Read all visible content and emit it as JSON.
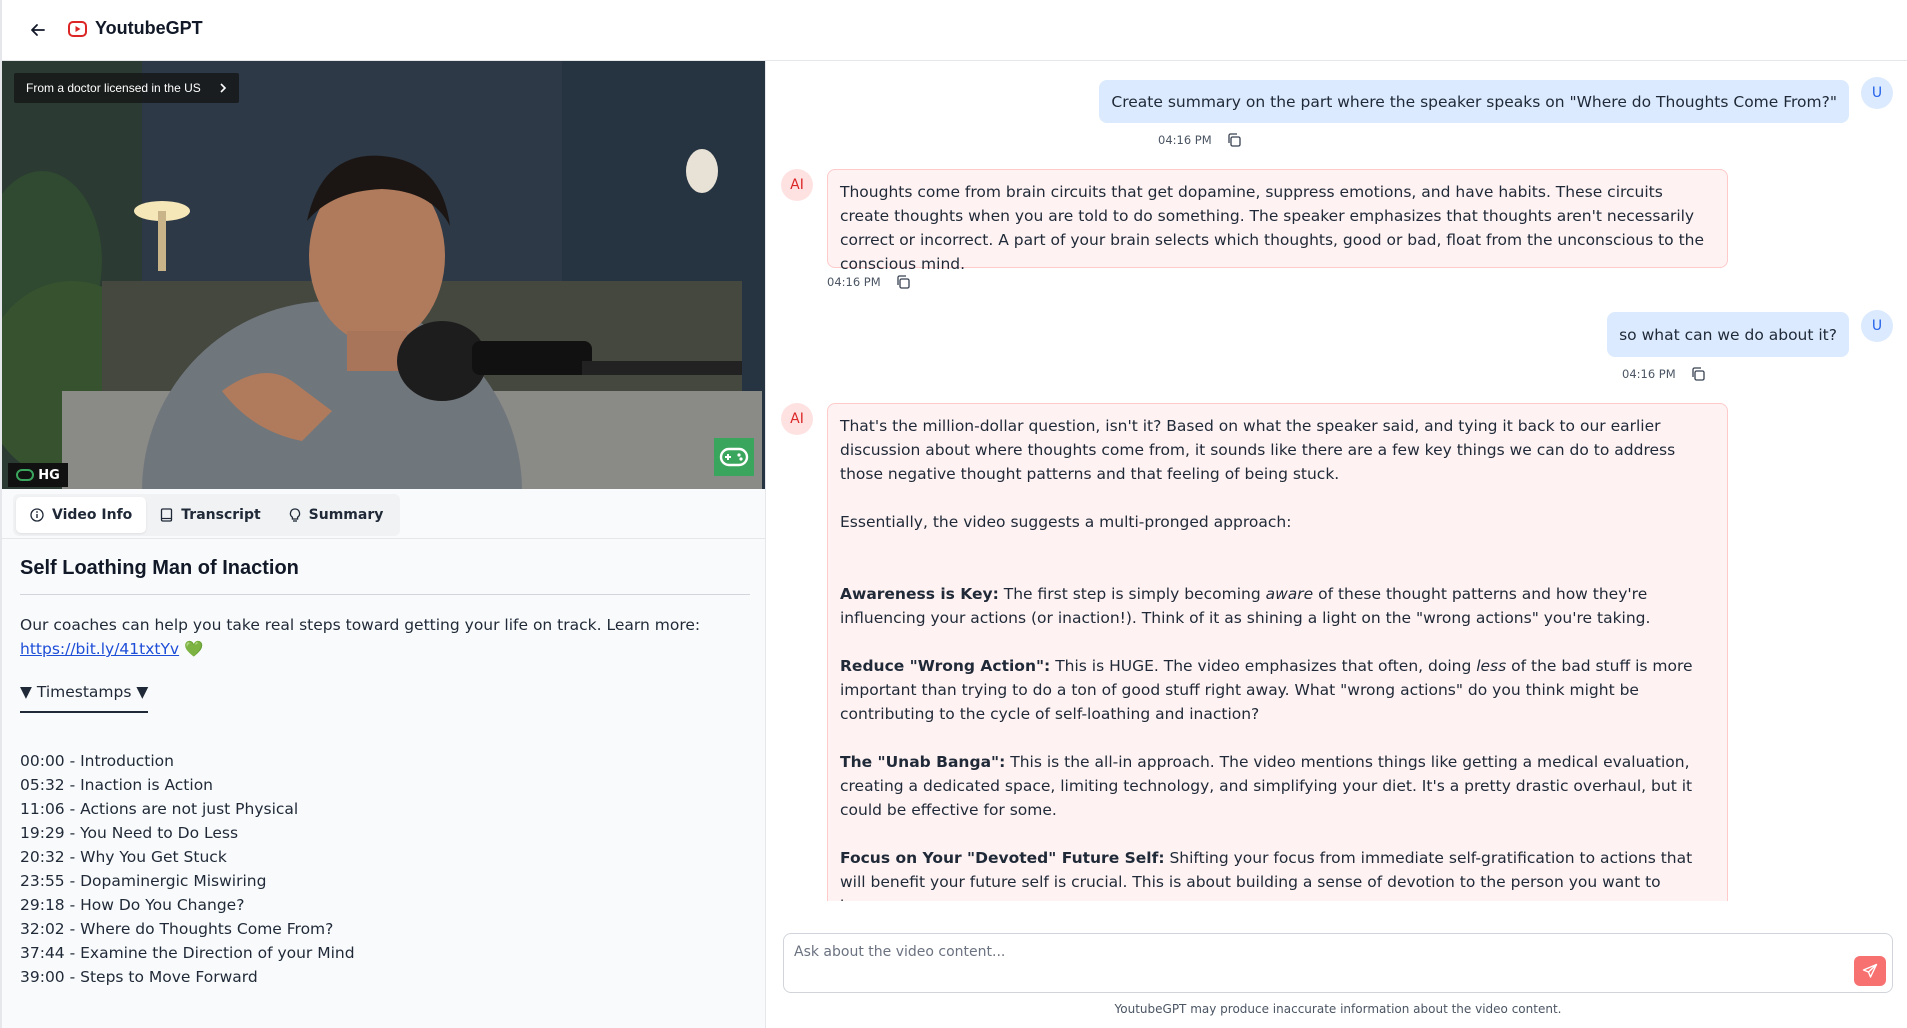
{
  "header": {
    "title": "YoutubeGPT",
    "back_icon": "arrow-left-icon",
    "logo_icon": "youtube-icon",
    "brand_color": "#dc2626"
  },
  "video": {
    "banner_text": "From a doctor licensed in the US",
    "badge_text": "HG"
  },
  "tabs": [
    {
      "label": "Video Info",
      "icon": "info-icon",
      "active": true
    },
    {
      "label": "Transcript",
      "icon": "book-icon",
      "active": false
    },
    {
      "label": "Summary",
      "icon": "lightbulb-icon",
      "active": false
    }
  ],
  "video_info": {
    "title": "Self Loathing Man of Inaction",
    "description": "Our coaches can help you take real steps toward getting your life on track. Learn more: ",
    "link_text": "https://​bit.ly/41txtYv",
    "heart": "💚",
    "timestamps_toggle": "▼ Timestamps ▼",
    "timestamps": [
      "00:00 - Introduction",
      "05:32 - Inaction is Action",
      "11:06 - Actions are not just Physical",
      "19:29 - You Need to Do Less",
      "20:32 - Why You Get Stuck",
      "23:55 - Dopaminergic Miswiring",
      "29:18 - How Do You Change?",
      "32:02 - Where do Thoughts Come From?",
      "37:44 - Examine the Direction of your Mind",
      "39:00 - Steps to Move Forward"
    ]
  },
  "chat": {
    "user_avatar": "U",
    "ai_avatar": "AI",
    "messages": [
      {
        "role": "user",
        "text": "Create summary on the part where the speaker speaks on \"Where do Thoughts Come From?\"",
        "time": "04:16 PM"
      },
      {
        "role": "ai",
        "text": "Thoughts come from brain circuits that get dopamine, suppress emotions, and have habits. These circuits create thoughts when you are told to do something. The speaker emphasizes that thoughts aren't necessarily correct or incorrect. A part of your brain selects which thoughts, good or bad, float from the unconscious to the conscious mind.",
        "time": "04:16 PM"
      },
      {
        "role": "user",
        "text": "so what can we do about it?",
        "time": "04:16 PM"
      },
      {
        "role": "ai",
        "intro": "That's the million-dollar question, isn't it? Based on what the speaker said, and tying it back to our earlier discussion about where thoughts come from, it sounds like there are a few key things we can do to address those negative thought patterns and that feeling of being stuck.",
        "lead": "Essentially, the video suggests a multi-pronged approach:",
        "points": [
          {
            "title": "Awareness is Key:",
            "pre": " The first step is simply becoming ",
            "em": "aware",
            "post": " of these thought patterns and how they're influencing your actions (or inaction!). Think of it as shining a light on the \"wrong actions\" you're taking."
          },
          {
            "title": "Reduce \"Wrong Action\":",
            "pre": " This is HUGE. The video emphasizes that often, doing ",
            "em": "less",
            "post": " of the bad stuff is more important than trying to do a ton of good stuff right away. What \"wrong actions\" do you think might be contributing to the cycle of self-loathing and inaction?"
          },
          {
            "title": "The \"Unab Banga\":",
            "pre": " This is the all-in approach. The video mentions things like getting a medical evaluation, creating a dedicated space, limiting technology, and simplifying your diet. It's a pretty drastic overhaul, but it could be effective for some.",
            "em": "",
            "post": ""
          },
          {
            "title": "Focus on Your \"Devoted\" Future Self:",
            "pre": " Shifting your focus from immediate self-gratification to actions that will benefit your future self is crucial. This is about building a sense of devotion to the person you want to become.",
            "em": "",
            "post": ""
          }
        ]
      }
    ]
  },
  "composer": {
    "placeholder": "Ask about the video content...",
    "send_icon": "send-icon",
    "disclaimer": "YoutubeGPT may produce inaccurate information about the video content."
  },
  "colors": {
    "user_bubble": "#dbeafe",
    "ai_bubble": "#fef2f2",
    "ai_border": "#fecaca",
    "send_button": "#f87171"
  }
}
